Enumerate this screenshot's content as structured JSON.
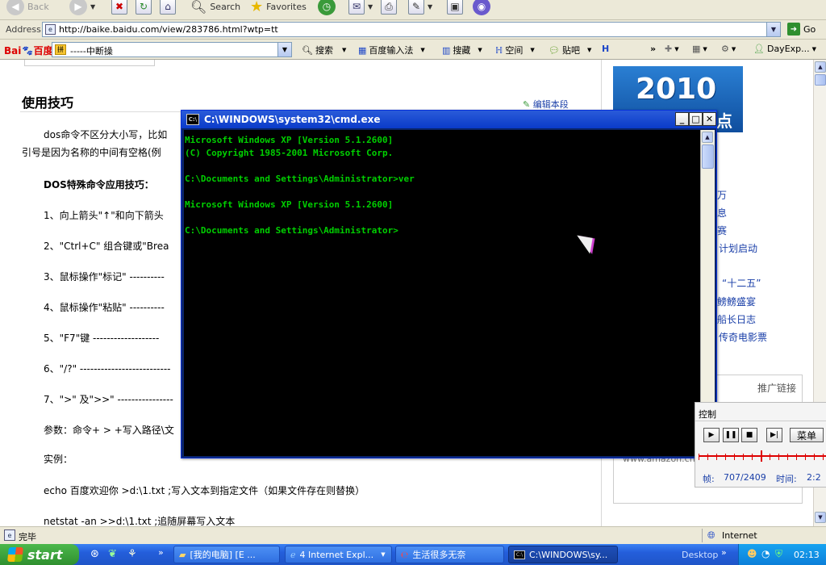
{
  "toolbar": {
    "back_label": "Back",
    "search_label": "Search",
    "favorites_label": "Favorites"
  },
  "address": {
    "label": "Address",
    "url": "http://baike.baidu.com/view/283786.html?wtp=tt",
    "go_label": "Go"
  },
  "baidu_toolbar": {
    "logo_main": "Bai",
    "logo_accent": "百度",
    "search_value": "-----中断操",
    "search_button": "搜索",
    "input_method": "百度输入法",
    "favorites": "搜藏",
    "space": "空间",
    "tieba": "贴吧",
    "more": "»",
    "dayexp": "DayExp..."
  },
  "page": {
    "heading": "使用技巧",
    "edit_link": "编辑本段",
    "para1_line1": "dos命令不区分大小写，比如",
    "para1_line2": "引号是因为名称的中间有空格(例",
    "subheading": "DOS特殊命令应用技巧：",
    "items": [
      "1、向上箭头\"↑\"和向下箭头",
      "2、\"Ctrl+C\" 组合键或\"Brea",
      "3、鼠标操作\"标记\" ----------",
      "4、鼠标操作\"粘贴\" ----------",
      "5、\"F7\"键 -------------------",
      "6、\"/?\" --------------------------",
      "7、\">\" 及\">>\" ----------------"
    ],
    "params": "参数：命令+ > +写入路径\\文",
    "example_label": "实例：",
    "example1": "echo 百度欢迎你 >d:\\1.txt ;写入文本到指定文件（如果文件存在则替换）",
    "example2": "netstat -an >>d:\\1.txt ;追随屏幕写入文本"
  },
  "sidebar": {
    "ad_year": "2010",
    "ad_suffix": "点",
    "links": [
      "万",
      "息",
      "赛",
      "计划启动",
      "“十二五”",
      "鳑鳑盛宴",
      "船长日志",
      "传奇电影票"
    ],
    "promo": "推广链接",
    "amazon_url": "www.amazon.cn"
  },
  "cmd": {
    "title": "C:\\WINDOWS\\system32\\cmd.exe",
    "icon_text": "C:\\",
    "lines": [
      "Microsoft Windows XP [Version 5.1.2600]",
      "(C) Copyright 1985-2001 Microsoft Corp.",
      "",
      "C:\\Documents and Settings\\Administrator>ver",
      "",
      "Microsoft Windows XP [Version 5.1.2600]",
      "",
      "C:\\Documents and Settings\\Administrator>"
    ]
  },
  "media": {
    "title": "控制",
    "menu_label": "菜单",
    "frame_label": "帧:",
    "frame_value": "707/2409",
    "time_label": "时间:",
    "time_value": "2:2"
  },
  "status": {
    "left": "完毕",
    "zone": "Internet"
  },
  "taskbar": {
    "start": "start",
    "tasks": [
      "[我的电脑] [E ...",
      "4 Internet Expl...",
      "生活很多无奈",
      "C:\\WINDOWS\\sy..."
    ],
    "desktop_label": "Desktop",
    "clock": "02:13"
  },
  "colors": {
    "console_text": "#00d000",
    "title_bar": "#0a3bc9",
    "taskbar": "#245edb"
  }
}
